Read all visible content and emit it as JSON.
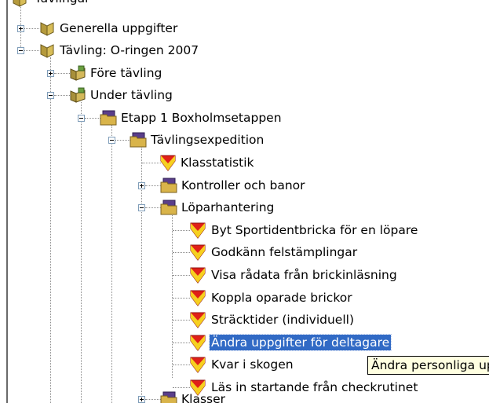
{
  "tree": {
    "top_partial": "Tävlingar",
    "nodes": [
      {
        "label": "Generella uppgifter",
        "icon": "book-icon",
        "expander": "plus"
      },
      {
        "label": "Tävling: O-ringen 2007",
        "icon": "book-icon",
        "expander": "minus"
      },
      {
        "label": "Före tävling",
        "icon": "books-icon",
        "expander": "plus"
      },
      {
        "label": "Under tävling",
        "icon": "books-icon",
        "expander": "minus"
      },
      {
        "label": "Etapp 1 Boxholmsetappen",
        "icon": "folder-icon",
        "expander": "minus"
      },
      {
        "label": "Tävlingsexpedition",
        "icon": "folder-icon",
        "expander": "minus"
      },
      {
        "label": "Klasstatistik",
        "icon": "shield-icon",
        "expander": null
      },
      {
        "label": "Kontroller och banor",
        "icon": "folder-icon",
        "expander": "plus"
      },
      {
        "label": "Löparhantering",
        "icon": "folder-icon",
        "expander": "minus"
      },
      {
        "label": "Byt Sportidentbricka för en löpare",
        "icon": "shield-icon",
        "expander": null
      },
      {
        "label": "Godkänn felstämplingar",
        "icon": "shield-icon",
        "expander": null
      },
      {
        "label": "Visa rådata från brickinläsning",
        "icon": "shield-icon",
        "expander": null
      },
      {
        "label": "Koppla oparade brickor",
        "icon": "shield-icon",
        "expander": null
      },
      {
        "label": "Sträcktider (individuell)",
        "icon": "shield-icon",
        "expander": null
      },
      {
        "label": "Ändra uppgifter för deltagare",
        "icon": "shield-icon",
        "expander": null,
        "selected": true
      },
      {
        "label": "Kvar i skogen",
        "icon": "shield-icon",
        "expander": null
      },
      {
        "label": "Läs in startande från checkrutinet",
        "icon": "shield-icon",
        "expander": null
      },
      {
        "label": "Klasser",
        "icon": "folder-icon",
        "expander": "plus"
      }
    ]
  },
  "tooltip": {
    "text": "Ändra personliga uppgifter"
  },
  "colors": {
    "selection": "#316ac5",
    "tooltip_bg": "#ffffe1",
    "folder": "#c8a040",
    "shield_red": "#e02018",
    "shield_yellow": "#f6d020"
  }
}
